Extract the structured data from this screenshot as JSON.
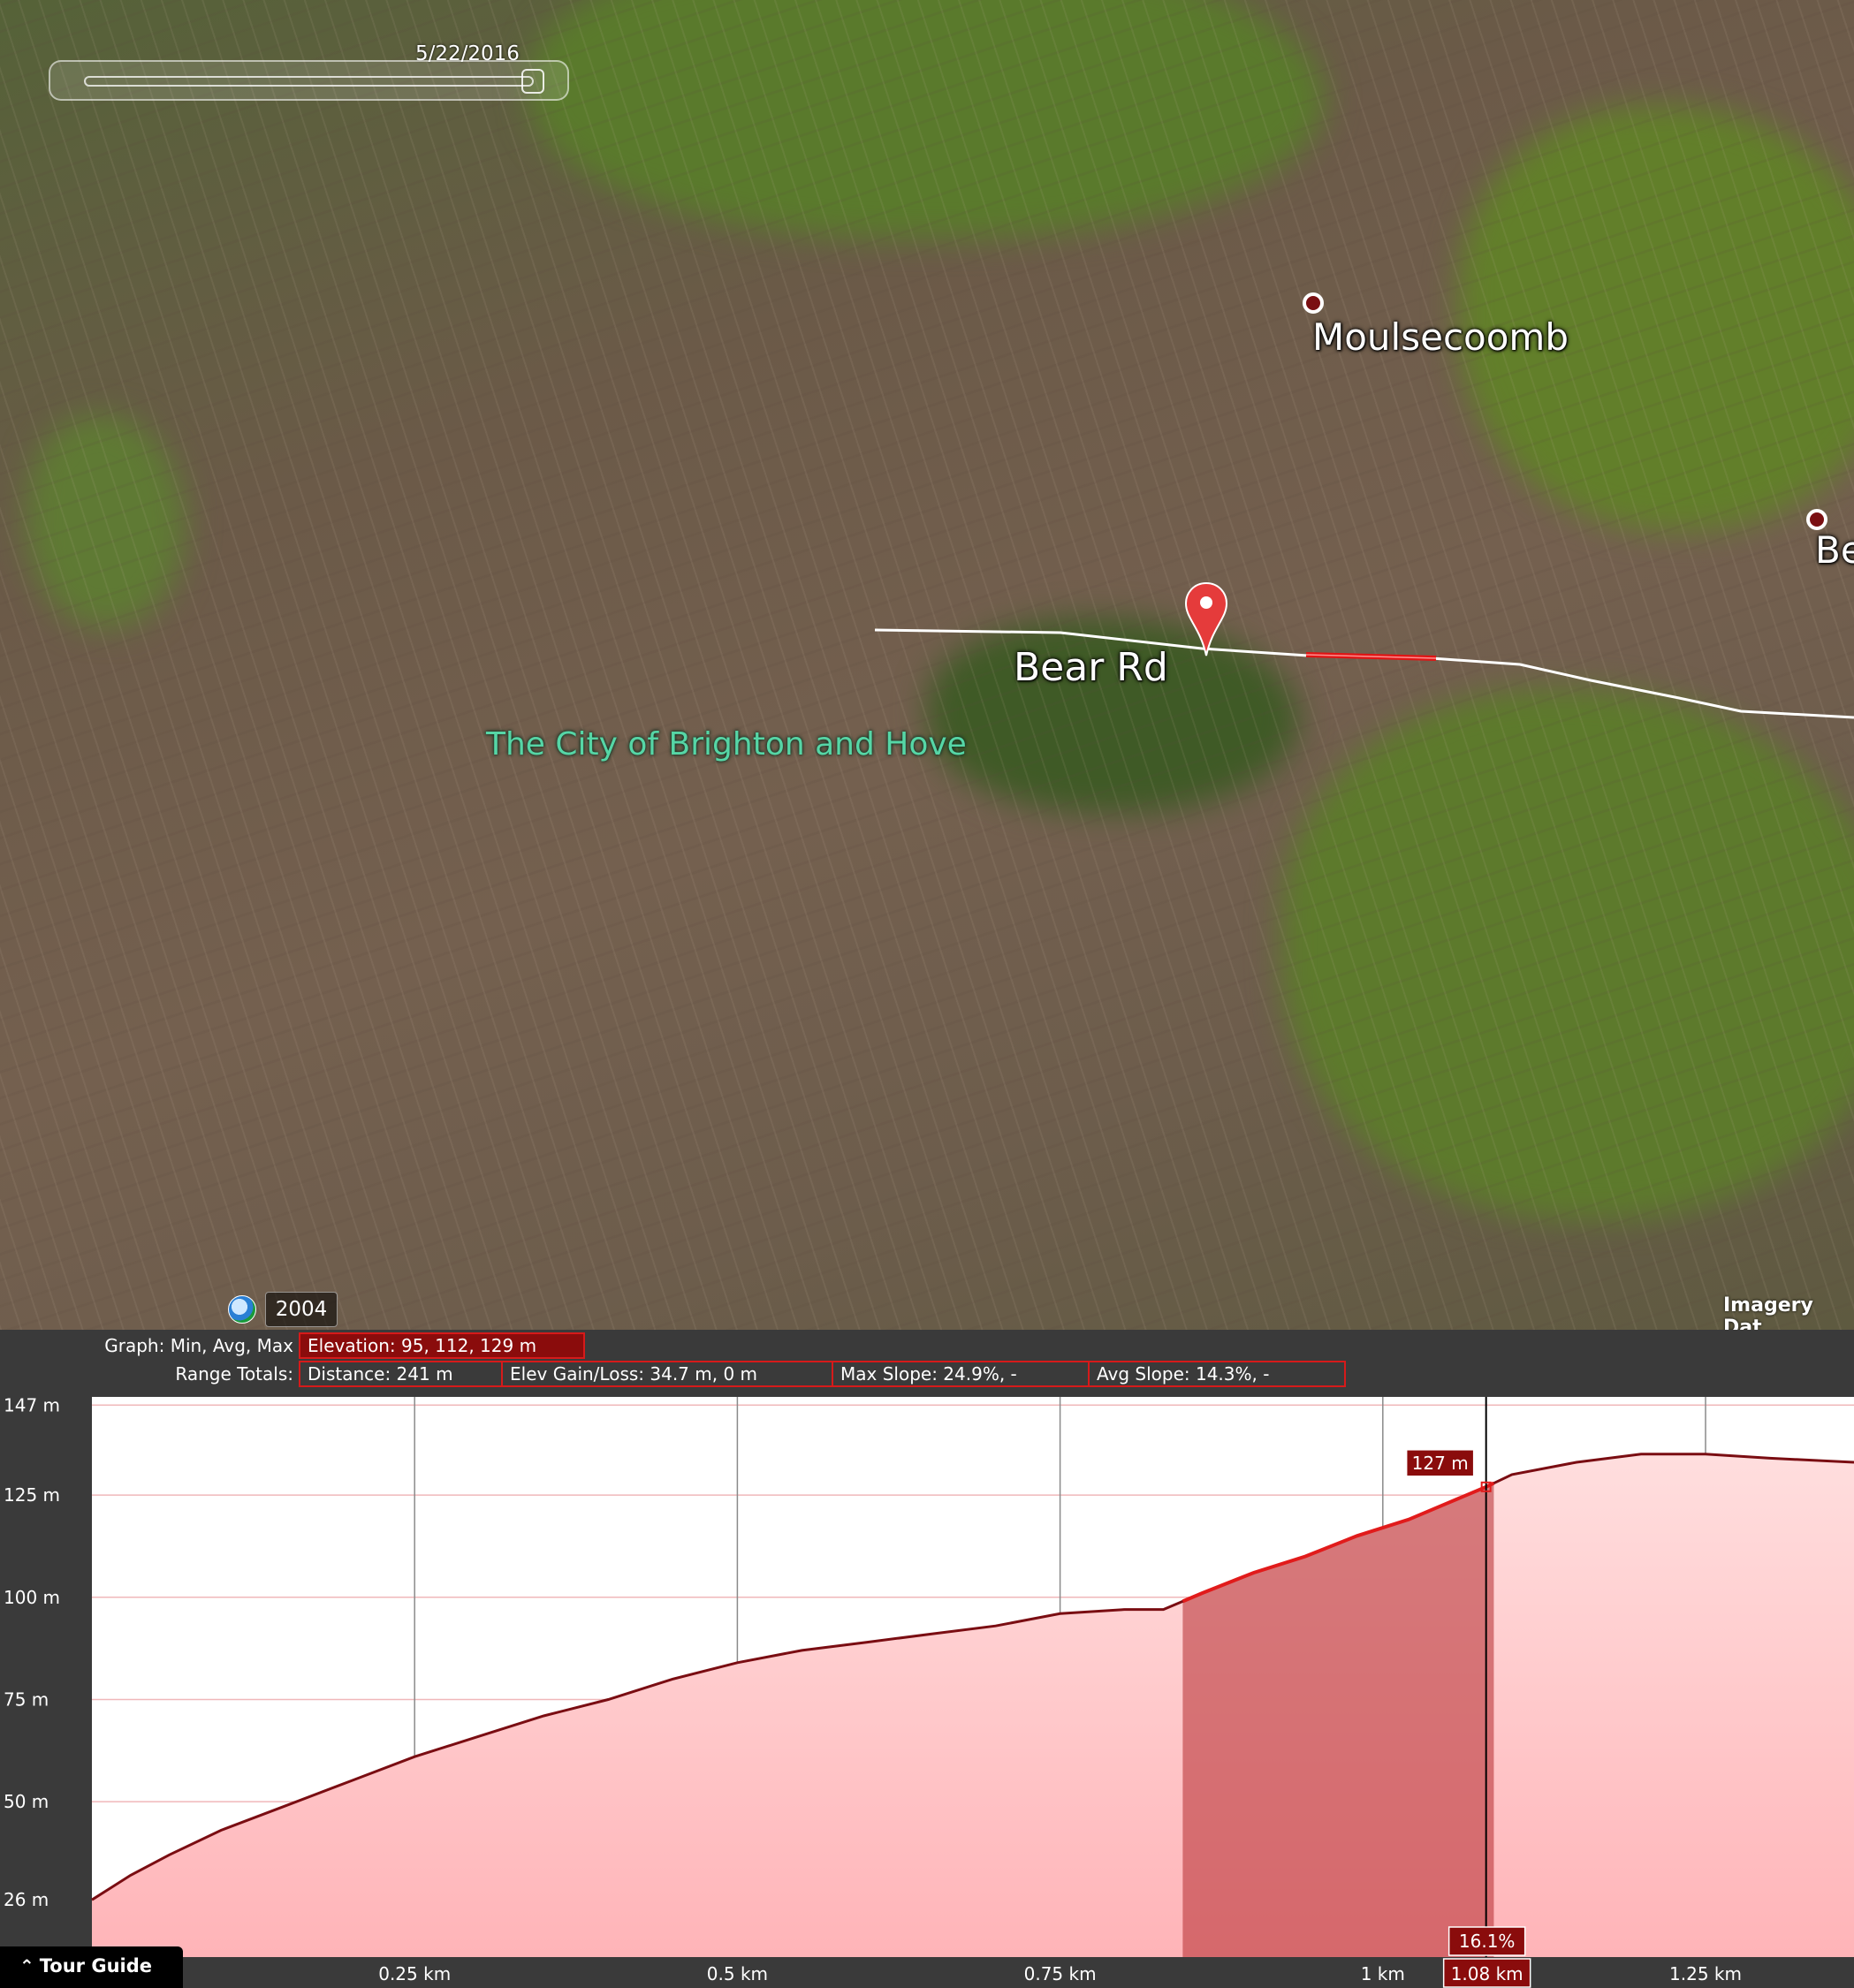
{
  "map": {
    "time_slider": {
      "date": "5/22/2016"
    },
    "labels": {
      "moulsecoomb": "Moulsecoomb",
      "bevendean_partial": "Be",
      "bear_rd": "Bear Rd",
      "city": "The City of Brighton and Hove"
    },
    "year": "2004",
    "imagery_credit": "Imagery Dat",
    "colors": {
      "city_label": "#56d6a6",
      "path_line": "#ffffff",
      "selection": "#e01515",
      "pin": "#e53b3b"
    }
  },
  "profile": {
    "graph_label": "Graph:",
    "graph_desc": "Min, Avg, Max",
    "elevation": "Elevation: 95, 112, 129 m",
    "range_totals_label": "Range Totals:",
    "distance": "Distance: 241 m",
    "elev_gain_loss": "Elev Gain/Loss: 34.7 m, 0 m",
    "max_slope": "Max Slope: 24.9%, -",
    "avg_slope": "Avg Slope: 14.3%, -",
    "cursor_elevation": "127 m",
    "cursor_slope": "16.1%",
    "cursor_distance": "1.08 km"
  },
  "tour_guide": {
    "label": "Tour Guide"
  },
  "chart_data": {
    "type": "area",
    "y_ticks": [
      {
        "value": 26,
        "label": "26 m"
      },
      {
        "value": 50,
        "label": "50 m"
      },
      {
        "value": 75,
        "label": "75 m"
      },
      {
        "value": 100,
        "label": "100 m"
      },
      {
        "value": 125,
        "label": "125 m"
      },
      {
        "value": 147,
        "label": "147 m"
      }
    ],
    "x_ticks": [
      {
        "value": 0.25,
        "label": "0.25 km"
      },
      {
        "value": 0.5,
        "label": "0.5 km"
      },
      {
        "value": 0.75,
        "label": "0.75 km"
      },
      {
        "value": 1.0,
        "label": "1 km"
      },
      {
        "value": 1.25,
        "label": "1.25 km"
      }
    ],
    "xlim": [
      0,
      1.365
    ],
    "ylim": [
      12,
      149
    ],
    "selection_range": [
      0.845,
      1.086
    ],
    "cursor_x": 1.08,
    "x": [
      0,
      0.03,
      0.06,
      0.1,
      0.15,
      0.2,
      0.25,
      0.3,
      0.35,
      0.4,
      0.45,
      0.5,
      0.55,
      0.6,
      0.65,
      0.7,
      0.75,
      0.8,
      0.83,
      0.86,
      0.9,
      0.94,
      0.98,
      1.02,
      1.05,
      1.08,
      1.1,
      1.15,
      1.2,
      1.25,
      1.3,
      1.365
    ],
    "y": [
      26,
      32,
      37,
      43,
      49,
      55,
      61,
      66,
      71,
      75,
      80,
      84,
      87,
      89,
      91,
      93,
      96,
      97,
      97,
      101,
      106,
      110,
      115,
      119,
      123,
      127,
      130,
      133,
      135,
      135,
      134,
      133
    ]
  }
}
